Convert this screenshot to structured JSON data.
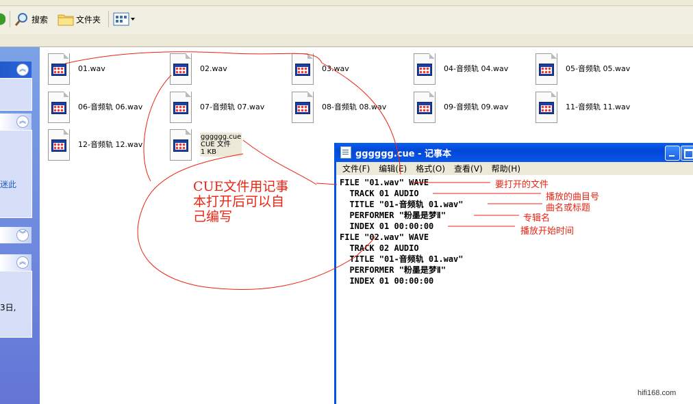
{
  "toolbar": {
    "search_label": "搜索",
    "folders_label": "文件夹"
  },
  "leftpane": {
    "link_text": "迷此",
    "detail_text": "3日,"
  },
  "files": [
    {
      "name": "01.wav"
    },
    {
      "name": "02.wav"
    },
    {
      "name": "03.wav"
    },
    {
      "name": "04-音频轨 04.wav"
    },
    {
      "name": "05-音频轨 05.wav"
    },
    {
      "name": "06-音频轨 06.wav"
    },
    {
      "name": "07-音频轨 07.wav"
    },
    {
      "name": "08-音频轨 08.wav"
    },
    {
      "name": "09-音频轨 09.wav"
    },
    {
      "name": "11-音频轨 11.wav"
    },
    {
      "name": "12-音频轨 12.wav"
    },
    {
      "name": "gggggg.cue",
      "type": "CUE 文件",
      "size": "1 KB"
    }
  ],
  "notepad": {
    "title": "gggggg.cue - 记事本",
    "menu": [
      "文件(F)",
      "编辑(E)",
      "格式(O)",
      "查看(V)",
      "帮助(H)"
    ],
    "lines": [
      "FILE \"01.wav\" WAVE",
      "  TRACK 01 AUDIO",
      "  TITLE \"01-音频轨 01.wav\"",
      "  PERFORMER \"粉墨是梦Ⅱ\"",
      "  INDEX 01 00:00:00",
      "FILE \"02.wav\" WAVE",
      "  TRACK 02 AUDIO",
      "  TITLE \"01-音频轨 01.wav\"",
      "  PERFORMER \"粉墨是梦Ⅱ\"",
      "  INDEX 01 00:00:00"
    ]
  },
  "annotations": {
    "file_to_open": "要打开的文件",
    "track_number": "播放的曲目号",
    "title_label": "曲名或标题",
    "album_name": "专辑名",
    "start_time": "播放开始时间",
    "note_line1": "CUE文件用记事",
    "note_line2": "本打开后可以自",
    "note_line3": "己编写"
  },
  "watermark": "hifi168.com",
  "colors": {
    "annotation": "#e21",
    "titlebar": "#0a56e8",
    "sidebar": "#6f8fe0"
  }
}
